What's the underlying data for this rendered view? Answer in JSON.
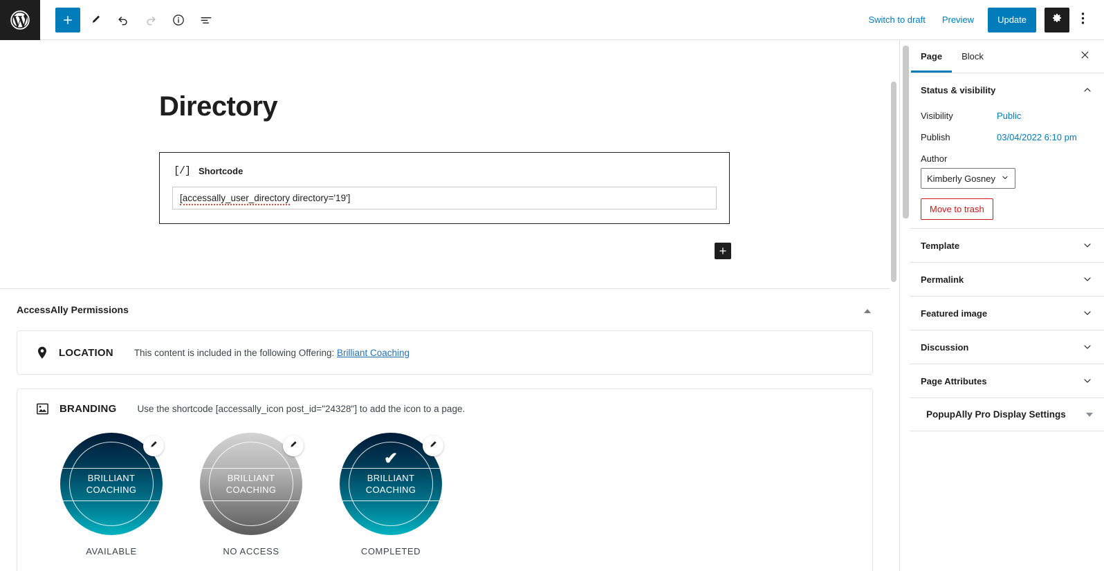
{
  "topbar": {
    "logo_icon": "wordpress-logo-icon",
    "tools": [
      {
        "name": "add-block-button",
        "icon": "plus-icon",
        "label": "Toggle block inserter"
      },
      {
        "name": "edit-tool-button",
        "icon": "pencil-icon",
        "label": "Tools"
      },
      {
        "name": "undo-button",
        "icon": "undo-arrow-icon",
        "label": "Undo"
      },
      {
        "name": "redo-button",
        "icon": "redo-arrow-icon",
        "label": "Redo"
      },
      {
        "name": "details-button",
        "icon": "info-circle-icon",
        "label": "Details"
      },
      {
        "name": "list-view-button",
        "icon": "list-view-icon",
        "label": "List view"
      }
    ],
    "switch_to_draft": "Switch to draft",
    "preview": "Preview",
    "update": "Update",
    "settings_icon": "gear-icon",
    "options_icon": "kebab-menu-icon"
  },
  "editor": {
    "page_title": "Directory",
    "shortcode_block": {
      "icon": "[/]",
      "title": "Shortcode",
      "value_misspelled": "[accessally_user_directory",
      "value_rest": " directory='19']"
    },
    "block_appender": "+"
  },
  "metabox": {
    "title": "AccessAlly Permissions",
    "toggle_icon": "collapse-triangle-icon",
    "location": {
      "icon": "map-pin-icon",
      "label": "LOCATION",
      "description": "This content is included in the following Offering:",
      "link": "Brilliant Coaching"
    },
    "branding": {
      "icon": "image-icon",
      "label": "BRANDING",
      "description": "Use the shortcode [accessally_icon post_id=\"24328\"] to add the icon to a page.",
      "badges": [
        {
          "text_line1": "BRILLIANT",
          "text_line2": "COACHING",
          "caption": "AVAILABLE",
          "style": "teal",
          "checkmark": "",
          "edit_icon": "pencil-icon"
        },
        {
          "text_line1": "BRILLIANT",
          "text_line2": "COACHING",
          "caption": "NO ACCESS",
          "style": "gray",
          "checkmark": "",
          "edit_icon": "pencil-icon"
        },
        {
          "text_line1": "BRILLIANT",
          "text_line2": "COACHING",
          "caption": "COMPLETED",
          "style": "teal",
          "checkmark": "✔",
          "edit_icon": "pencil-icon"
        }
      ]
    }
  },
  "sidebar": {
    "tabs": [
      {
        "label": "Page",
        "active": true
      },
      {
        "label": "Block",
        "active": false
      }
    ],
    "close_icon": "close-x-icon",
    "status_panel": {
      "title": "Status & visibility",
      "chevron": "chevron-up-icon",
      "visibility_label": "Visibility",
      "visibility_value": "Public",
      "publish_label": "Publish",
      "publish_value": "03/04/2022 6:10 pm",
      "author_label": "Author",
      "author_value": "Kimberly Gosney",
      "trash_label": "Move to trash"
    },
    "panels": [
      {
        "title": "Template",
        "chevron": "chevron-down-icon"
      },
      {
        "title": "Permalink",
        "chevron": "chevron-down-icon"
      },
      {
        "title": "Featured image",
        "chevron": "chevron-down-icon"
      },
      {
        "title": "Discussion",
        "chevron": "chevron-down-icon"
      },
      {
        "title": "Page Attributes",
        "chevron": "chevron-down-icon"
      }
    ],
    "popup_panel": {
      "title": "PopupAlly Pro Display Settings",
      "arrow": "triangle-down-icon"
    }
  },
  "colors": {
    "accent": "#007cba",
    "link": "#2271b1",
    "danger": "#cc1818",
    "dark": "#1e1e1e",
    "badge_teal_top": "#001b38",
    "badge_teal_bottom": "#00b2c0",
    "badge_gray_top": "#d3d3d3",
    "badge_gray_bottom": "#5c5c5c"
  }
}
